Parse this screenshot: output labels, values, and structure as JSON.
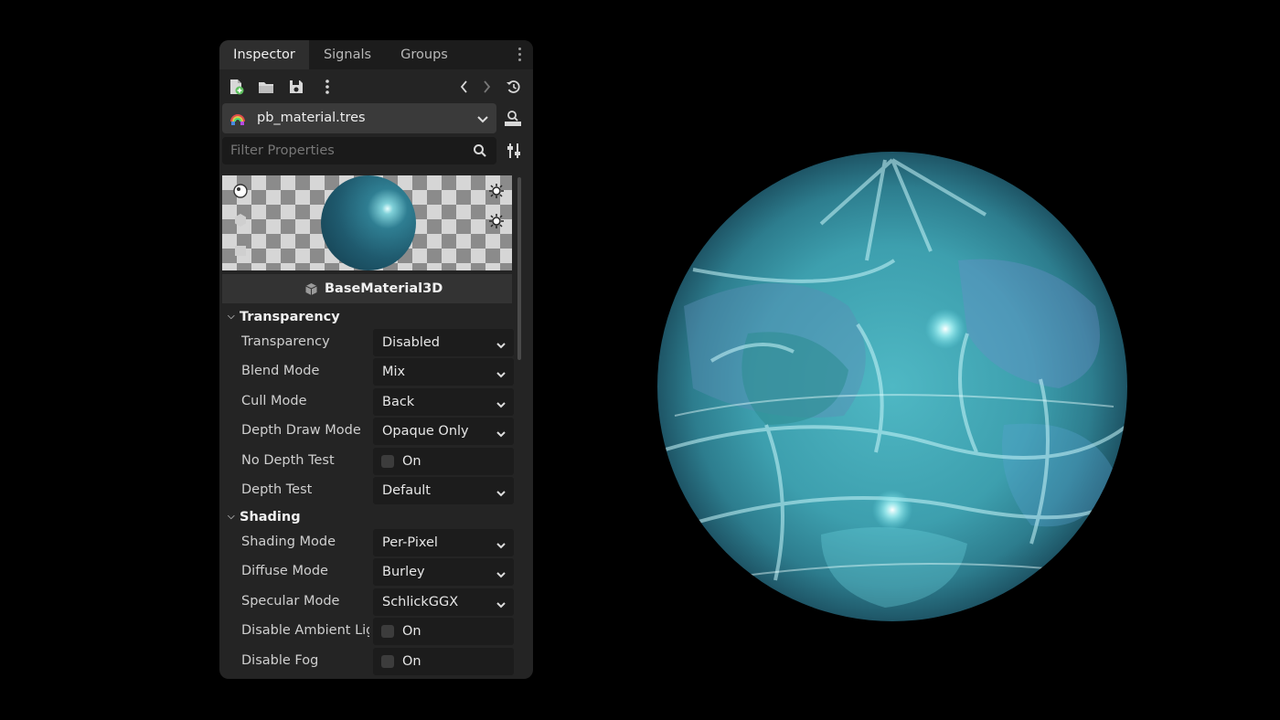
{
  "tabs": [
    {
      "label": "Inspector",
      "active": true
    },
    {
      "label": "Signals",
      "active": false
    },
    {
      "label": "Groups",
      "active": false
    }
  ],
  "toolbar": {
    "icons": [
      "new-resource-icon",
      "open-folder-icon",
      "save-icon",
      "more-options-icon",
      "history-back-icon",
      "history-forward-icon",
      "object-history-icon"
    ]
  },
  "resource": {
    "name": "pb_material.tres",
    "icon": "material-icon",
    "doc_icon": "doc-search-icon"
  },
  "filter": {
    "placeholder": "Filter Properties",
    "search_icon": "search-icon",
    "settings_icon": "property-settings-icon"
  },
  "preview": {
    "left_icons": [
      "sphere-preview-icon",
      "mesh-preview-icon",
      "box-preview-icon"
    ],
    "right_icons": [
      "light-1-icon",
      "light-2-icon"
    ]
  },
  "class_name": "BaseMaterial3D",
  "sections": [
    {
      "title": "Transparency",
      "props": [
        {
          "label": "Transparency",
          "value": "Disabled",
          "kind": "dropdown"
        },
        {
          "label": "Blend Mode",
          "value": "Mix",
          "kind": "dropdown"
        },
        {
          "label": "Cull Mode",
          "value": "Back",
          "kind": "dropdown"
        },
        {
          "label": "Depth Draw Mode",
          "value": "Opaque Only",
          "kind": "dropdown"
        },
        {
          "label": "No Depth Test",
          "value": "On",
          "kind": "checkbox"
        },
        {
          "label": "Depth Test",
          "value": "Default",
          "kind": "dropdown"
        }
      ]
    },
    {
      "title": "Shading",
      "props": [
        {
          "label": "Shading Mode",
          "value": "Per-Pixel",
          "kind": "dropdown"
        },
        {
          "label": "Diffuse Mode",
          "value": "Burley",
          "kind": "dropdown"
        },
        {
          "label": "Specular Mode",
          "value": "SchlickGGX",
          "kind": "dropdown"
        },
        {
          "label": "Disable Ambient Lig",
          "value": "On",
          "kind": "checkbox"
        },
        {
          "label": "Disable Fog",
          "value": "On",
          "kind": "checkbox"
        }
      ]
    }
  ],
  "colors": {
    "panel_bg": "#242424",
    "field_bg": "#1c1c1c",
    "accent_sphere": "#4fb8c4"
  }
}
